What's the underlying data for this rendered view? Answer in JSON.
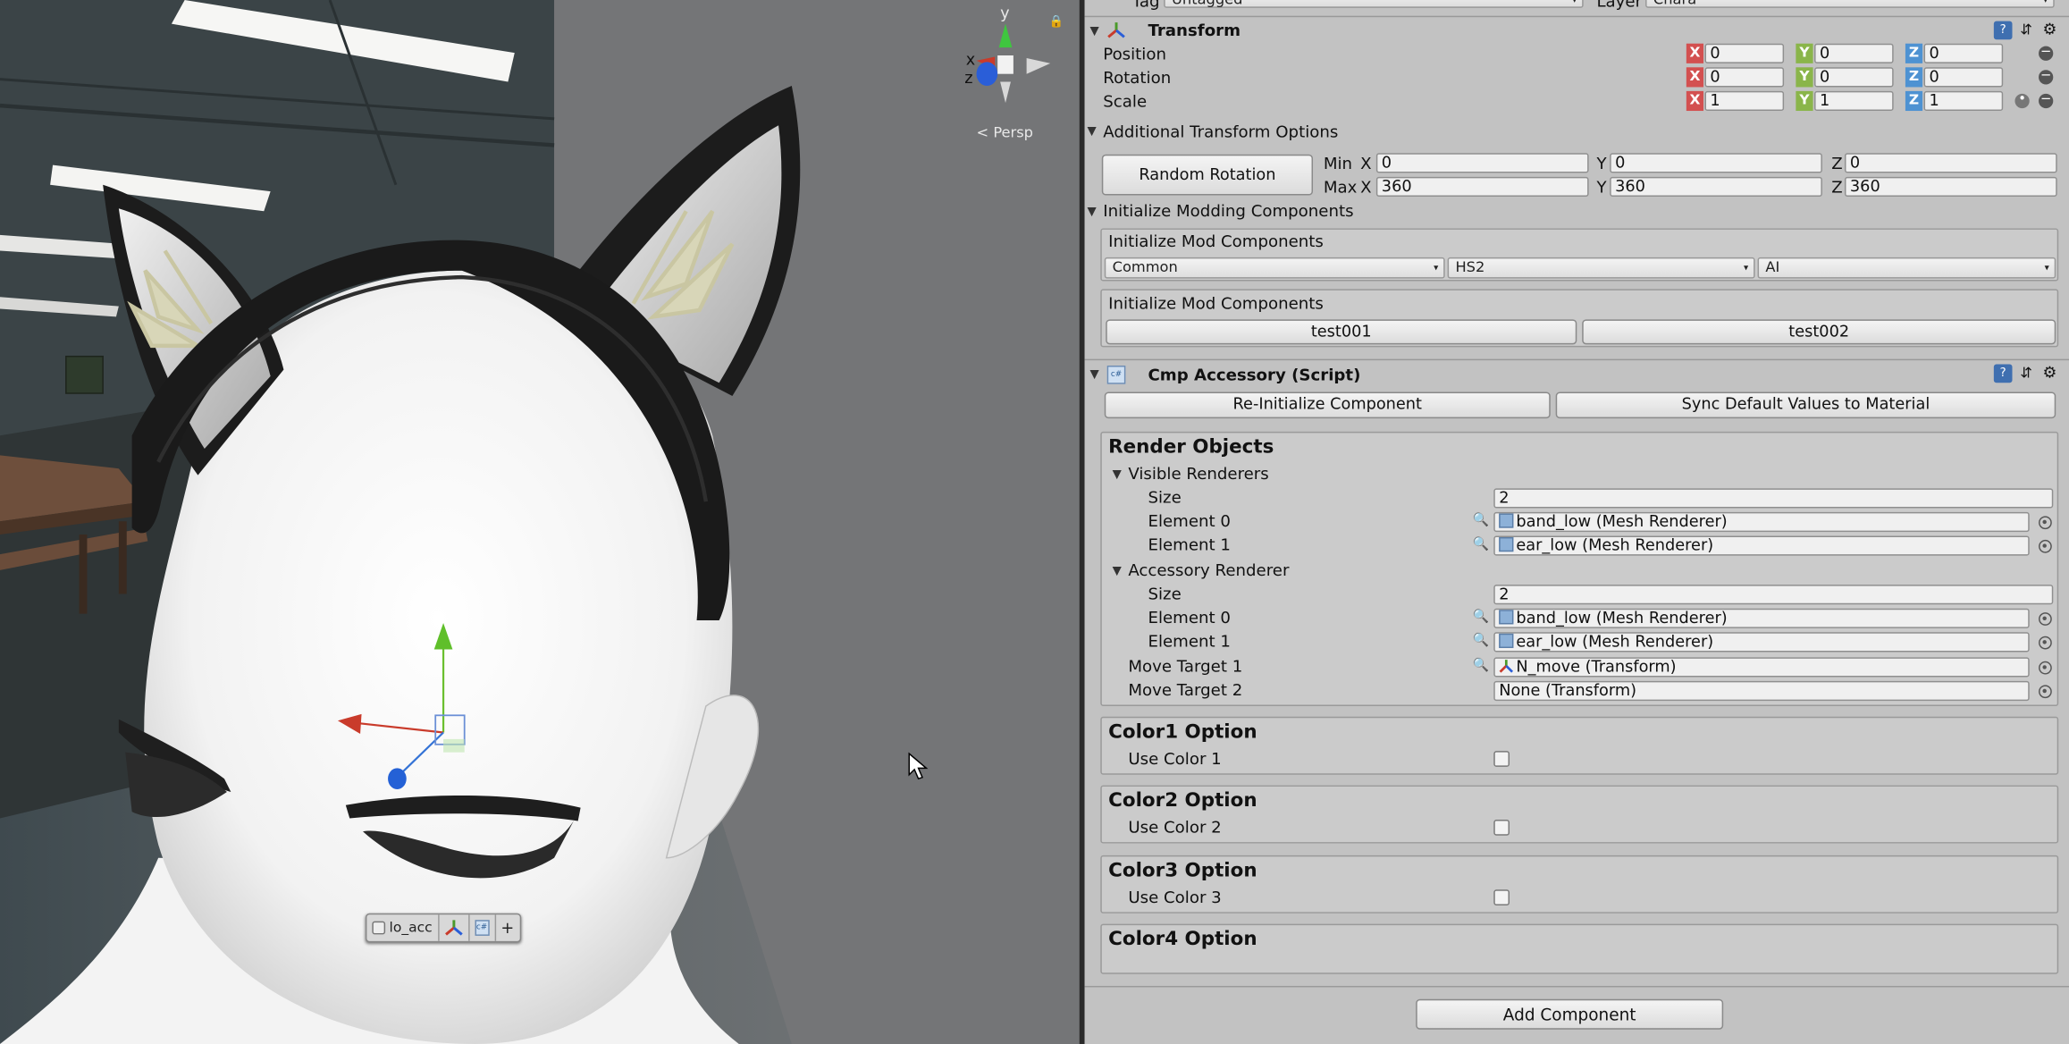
{
  "scene": {
    "persp_label": "Persp",
    "gizmo_axes": {
      "x": "x",
      "y": "y",
      "z": "z"
    },
    "toolbar": {
      "name": "lo_acc"
    }
  },
  "inspector": {
    "top": {
      "tag_label": "Tag",
      "tag_value": "Untagged",
      "layer_label": "Layer",
      "layer_value": "Chara"
    },
    "transform": {
      "title": "Transform",
      "position": {
        "label": "Position",
        "x": "0",
        "y": "0",
        "z": "0"
      },
      "rotation": {
        "label": "Rotation",
        "x": "0",
        "y": "0",
        "z": "0"
      },
      "scale": {
        "label": "Scale",
        "x": "1",
        "y": "1",
        "z": "1"
      },
      "axis_x": "X",
      "axis_y": "Y",
      "axis_z": "Z"
    },
    "additional": {
      "title": "Additional Transform Options",
      "random_rotation": "Random Rotation",
      "min_label": "Min",
      "max_label": "Max",
      "x": "X",
      "y": "Y",
      "z": "Z",
      "min": {
        "x": "0",
        "y": "0",
        "z": "0"
      },
      "max": {
        "x": "360",
        "y": "360",
        "z": "360"
      }
    },
    "init_mod": {
      "title": "Initialize Modding Components",
      "box1_title": "Initialize Mod Components",
      "dropdowns": [
        "Common",
        "HS2",
        "AI"
      ],
      "box2_title": "Initialize Mod Components",
      "buttons": [
        "test001",
        "test002"
      ]
    },
    "cmp": {
      "title": "Cmp Accessory (Script)",
      "reinit": "Re-Initialize Component",
      "sync": "Sync Default Values to Material",
      "render_objects": "Render Objects",
      "visible_renderers": "Visible Renderers",
      "size_label": "Size",
      "visible_size": "2",
      "element0_label": "Element 0",
      "element1_label": "Element 1",
      "visible_e0": "band_low (Mesh Renderer)",
      "visible_e1": "ear_low (Mesh Renderer)",
      "accessory_renderer": "Accessory Renderer",
      "acc_size": "2",
      "acc_e0": "band_low (Mesh Renderer)",
      "acc_e1": "ear_low (Mesh Renderer)",
      "move1_label": "Move Target 1",
      "move1_value": "N_move (Transform)",
      "move2_label": "Move Target 2",
      "move2_value": "None (Transform)",
      "color1_title": "Color1 Option",
      "color1_label": "Use Color 1",
      "color2_title": "Color2 Option",
      "color2_label": "Use Color 2",
      "color3_title": "Color3 Option",
      "color3_label": "Use Color 3",
      "color4_title": "Color4 Option"
    },
    "add_component": "Add Component"
  }
}
